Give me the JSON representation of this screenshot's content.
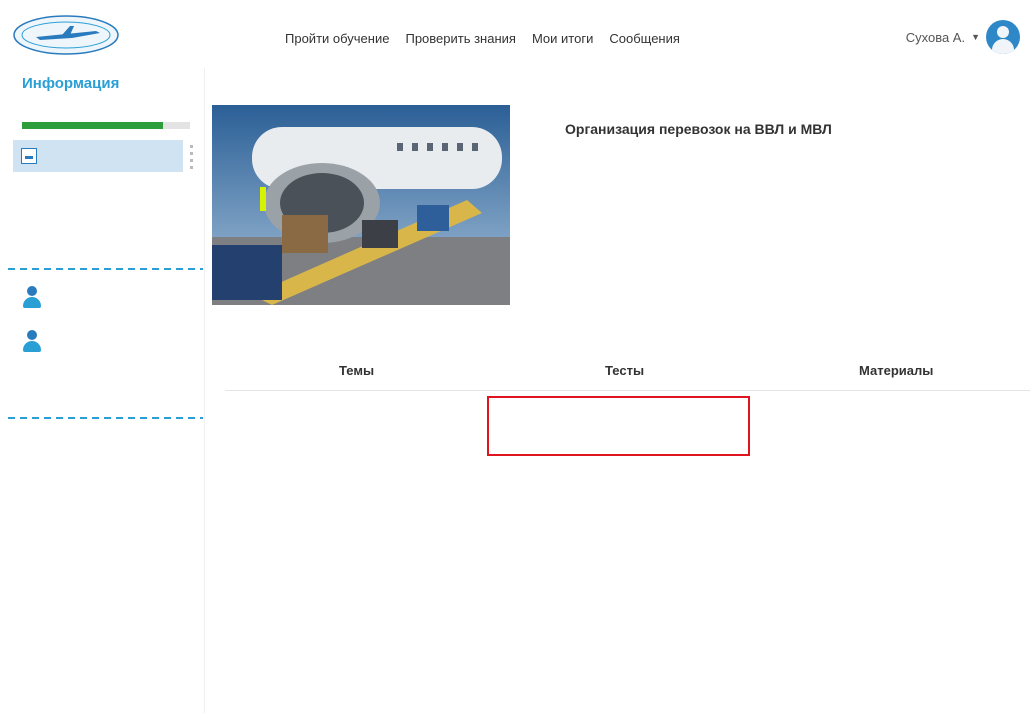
{
  "header": {
    "nav": [
      "Пройти обучение",
      "Проверить знания",
      "Мои итоги",
      "Сообщения"
    ],
    "user_name": "Сухова А."
  },
  "sidebar": {
    "info_title": "Информация",
    "progress_text": "",
    "progress_fraction": 0.84,
    "results_button": "",
    "modules": [
      {
        "date": "",
        "name": ""
      },
      {
        "date": "",
        "name": ""
      }
    ],
    "links": [
      {
        "label": ""
      },
      {
        "label": ""
      }
    ],
    "text_links": [
      "",
      ""
    ]
  },
  "content": {
    "breadcrumb": "",
    "course_title": "Организация перевозок на ВВЛ и МВЛ",
    "course_subtitle": "",
    "columns": [
      "Темы",
      "Тесты",
      "Материалы"
    ],
    "topics": [
      {
        "text": "",
        "status": ""
      },
      {
        "text": "",
        "status": ""
      },
      {
        "text": "",
        "status": ""
      },
      {
        "text": "",
        "status": ""
      },
      {
        "text": "",
        "status": ""
      }
    ],
    "tests": [
      ""
    ]
  },
  "colors": {
    "accent": "#2a9fd6",
    "progress": "#2e9d3c",
    "highlight": "#e0141e"
  }
}
